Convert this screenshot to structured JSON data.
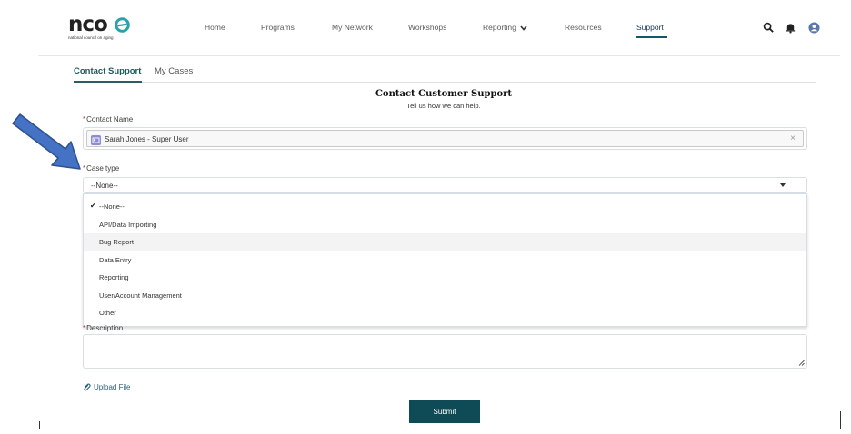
{
  "header": {
    "logo_text": "nco",
    "logo_subtitle": "national council on aging",
    "nav": [
      {
        "label": "Home"
      },
      {
        "label": "Programs"
      },
      {
        "label": "My Network"
      },
      {
        "label": "Workshops"
      },
      {
        "label": "Reporting",
        "icon": "chevron-down-icon"
      },
      {
        "label": "Resources"
      },
      {
        "label": "Support",
        "active": true
      }
    ],
    "icons": [
      "search-icon",
      "bell-icon",
      "user-avatar-icon"
    ]
  },
  "tabs": [
    {
      "label": "Contact Support",
      "active": true
    },
    {
      "label": "My Cases"
    }
  ],
  "form": {
    "title": "Contact Customer Support",
    "subtitle": "Tell us how we can help.",
    "contact_name": {
      "label": "Contact Name",
      "required": "*",
      "value": "Sarah Jones - Super User",
      "clear_icon": "×"
    },
    "case_type": {
      "label": "Case type",
      "required": "*",
      "value": "--None--",
      "options": [
        {
          "label": "--None--",
          "selected": true
        },
        {
          "label": "API/Data Importing"
        },
        {
          "label": "Bug Report",
          "hovered": true
        },
        {
          "label": "Data Entry"
        },
        {
          "label": "Reporting"
        },
        {
          "label": "User/Account Management"
        },
        {
          "label": "Other"
        }
      ]
    },
    "description": {
      "label": "Description",
      "required": "*",
      "value": ""
    },
    "upload_label": "Upload File",
    "submit_label": "Submit"
  },
  "colors": {
    "accent": "#0f4b56",
    "tab_active": "#1b5a5a",
    "arrow": "#4472c4",
    "required": "#c23934"
  }
}
